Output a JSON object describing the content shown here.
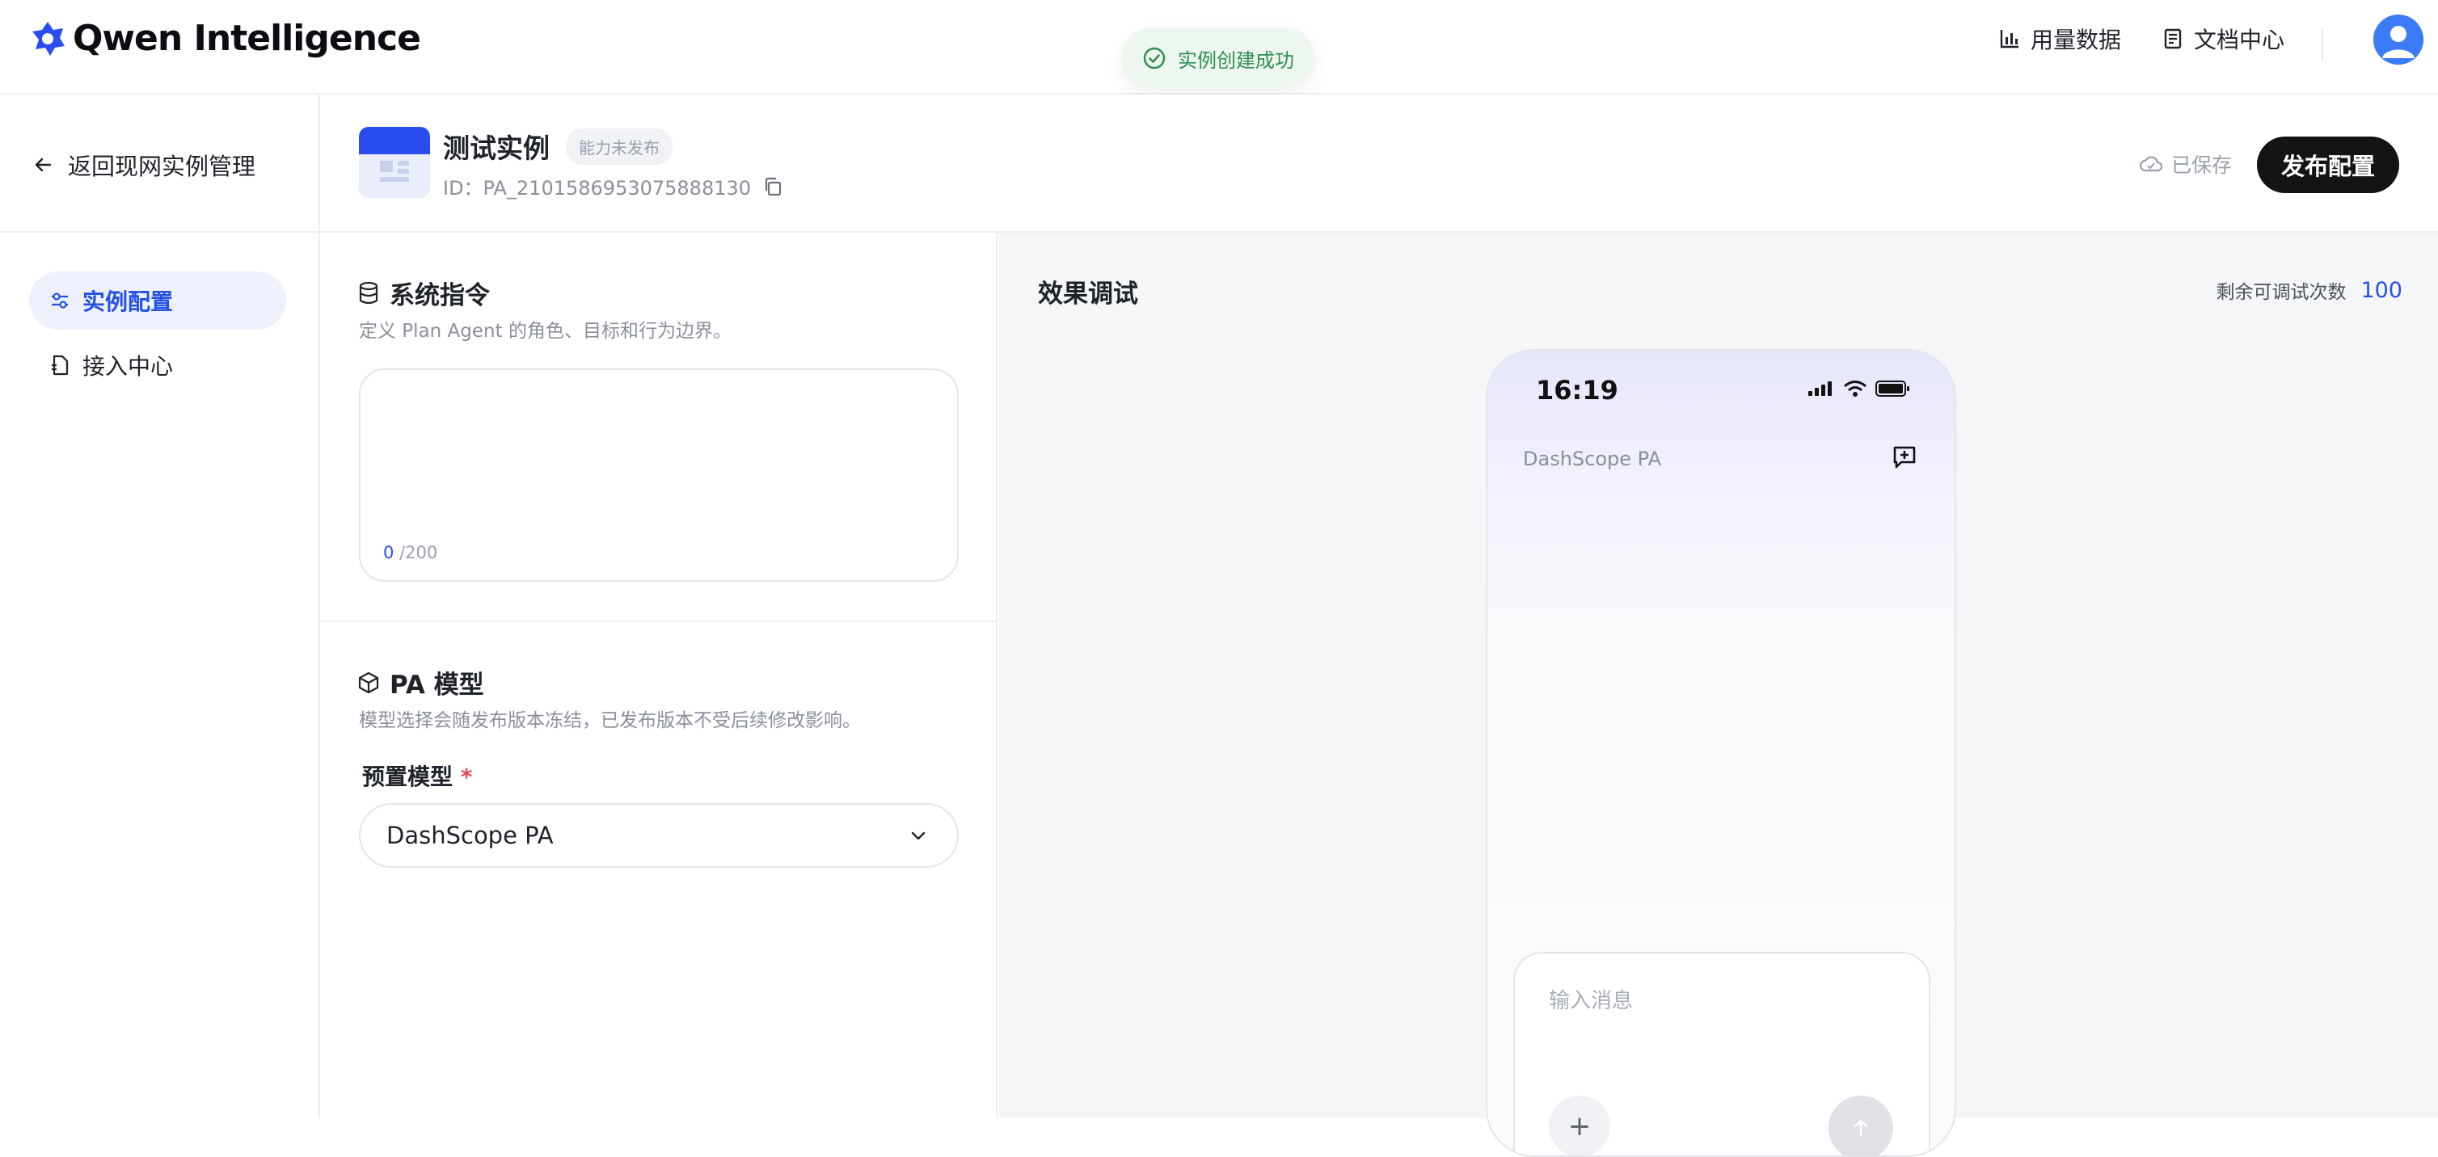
{
  "header": {
    "brand": "Qwen Intelligence",
    "toast": "实例创建成功",
    "nav": [
      {
        "label": "用量数据",
        "icon": "bar-chart-icon"
      },
      {
        "label": "文档中心",
        "icon": "document-icon"
      }
    ],
    "avatar_icon": "user-avatar-icon"
  },
  "subheader": {
    "back_label": "返回现网实例管理",
    "instance_name": "测试实例",
    "badge": "能力未发布",
    "instance_id": "ID：PA_2101586953075888130",
    "saved_label": "已保存",
    "publish_label": "发布配置"
  },
  "sidebar": {
    "items": [
      {
        "label": "实例配置",
        "icon": "sliders-icon",
        "active": true
      },
      {
        "label": "接入中心",
        "icon": "file-link-icon",
        "active": false
      }
    ]
  },
  "config": {
    "system": {
      "title": "系统指令",
      "description": "定义 Plan Agent 的角色、目标和行为边界。",
      "prompt_value": "",
      "count_current": "0",
      "count_max": "/200"
    },
    "model": {
      "title": "PA 模型",
      "description": "模型选择会随发布版本冻结，已发布版本不受后续修改影响。",
      "field_label": "预置模型",
      "required_mark": "*",
      "selected": "DashScope PA"
    }
  },
  "debug": {
    "title": "效果调试",
    "remaining_label": "剩余可调试次数",
    "remaining_value": "100",
    "phone": {
      "time": "16:19",
      "app_name": "DashScope PA",
      "input_placeholder": "输入消息",
      "plus_label": "+"
    }
  },
  "colors": {
    "accent": "#2451e6",
    "publish_bg": "#131416",
    "toast_bg": "#edf7f0",
    "toast_text": "#2e8f4e",
    "required": "#e5484d"
  }
}
